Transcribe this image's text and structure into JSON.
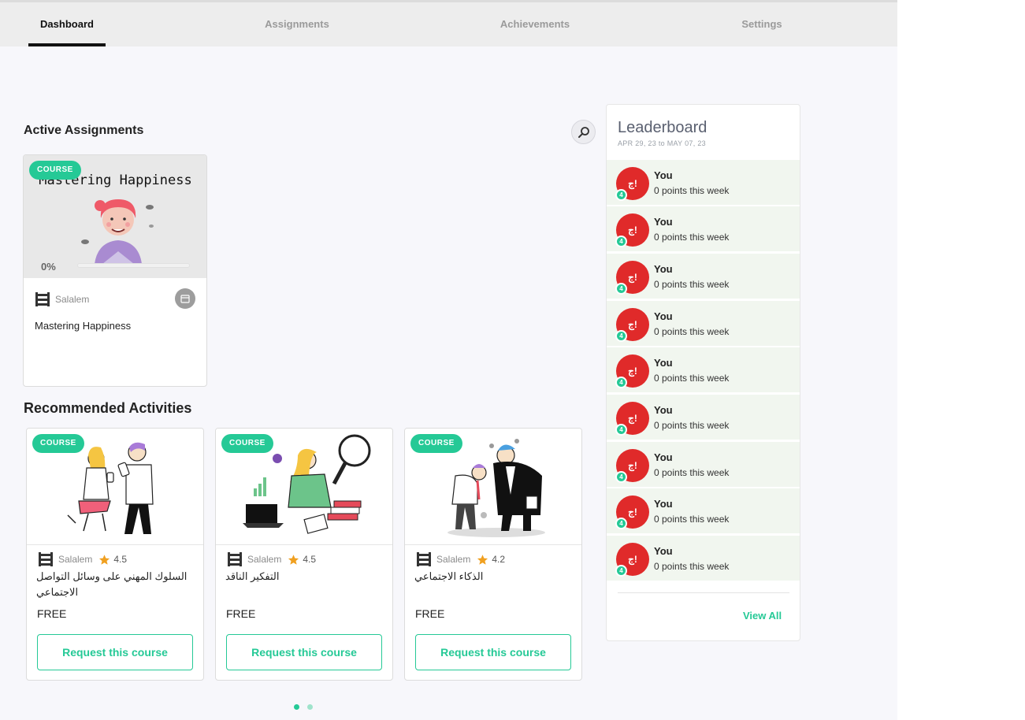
{
  "tabs": [
    {
      "label": "Dashboard",
      "active": true
    },
    {
      "label": "Assignments",
      "active": false
    },
    {
      "label": "Achievements",
      "active": false
    },
    {
      "label": "Settings",
      "active": false
    }
  ],
  "active_assignments": {
    "title": "Active Assignments",
    "search_icon": "search-icon",
    "card": {
      "badge": "COURSE",
      "thumb_title": "Mastering Happiness",
      "progress_label": "0%",
      "progress": 0,
      "provider": "Salalem",
      "calendar_icon": "calendar-icon",
      "name": "Mastering Happiness"
    }
  },
  "recommended": {
    "title": "Recommended Activities",
    "cards": [
      {
        "badge": "COURSE",
        "provider": "Salalem",
        "rating": "4.5",
        "title": "السلوك المهني على وسائل التواصل الاجتماعي",
        "price": "FREE",
        "button": "Request this course"
      },
      {
        "badge": "COURSE",
        "provider": "Salalem",
        "rating": "4.5",
        "title": "التفكير الناقد",
        "price": "FREE",
        "button": "Request this course"
      },
      {
        "badge": "COURSE",
        "provider": "Salalem",
        "rating": "4.2",
        "title": "الذكاء الاجتماعي",
        "price": "FREE",
        "button": "Request this course"
      }
    ],
    "pager": {
      "pages": 2,
      "current": 1
    }
  },
  "leaderboard": {
    "title": "Leaderboard",
    "range": "APR 29, 23 to MAY 07, 23",
    "entries": [
      {
        "name": "You",
        "points": "0 points this week",
        "rank": "4",
        "avatar": "ج!"
      },
      {
        "name": "You",
        "points": "0 points this week",
        "rank": "4",
        "avatar": "ج!"
      },
      {
        "name": "You",
        "points": "0 points this week",
        "rank": "4",
        "avatar": "ج!"
      },
      {
        "name": "You",
        "points": "0 points this week",
        "rank": "4",
        "avatar": "ج!"
      },
      {
        "name": "You",
        "points": "0 points this week",
        "rank": "4",
        "avatar": "ج!"
      },
      {
        "name": "You",
        "points": "0 points this week",
        "rank": "4",
        "avatar": "ج!"
      },
      {
        "name": "You",
        "points": "0 points this week",
        "rank": "4",
        "avatar": "ج!"
      },
      {
        "name": "You",
        "points": "0 points this week",
        "rank": "4",
        "avatar": "ج!"
      },
      {
        "name": "You",
        "points": "0 points this week",
        "rank": "4",
        "avatar": "ج!"
      }
    ],
    "view_all": "View All"
  },
  "colors": {
    "accent": "#25c996",
    "avatar": "#e02a2a",
    "row_bg": "#f1f6ef",
    "star": "#f0a020"
  }
}
